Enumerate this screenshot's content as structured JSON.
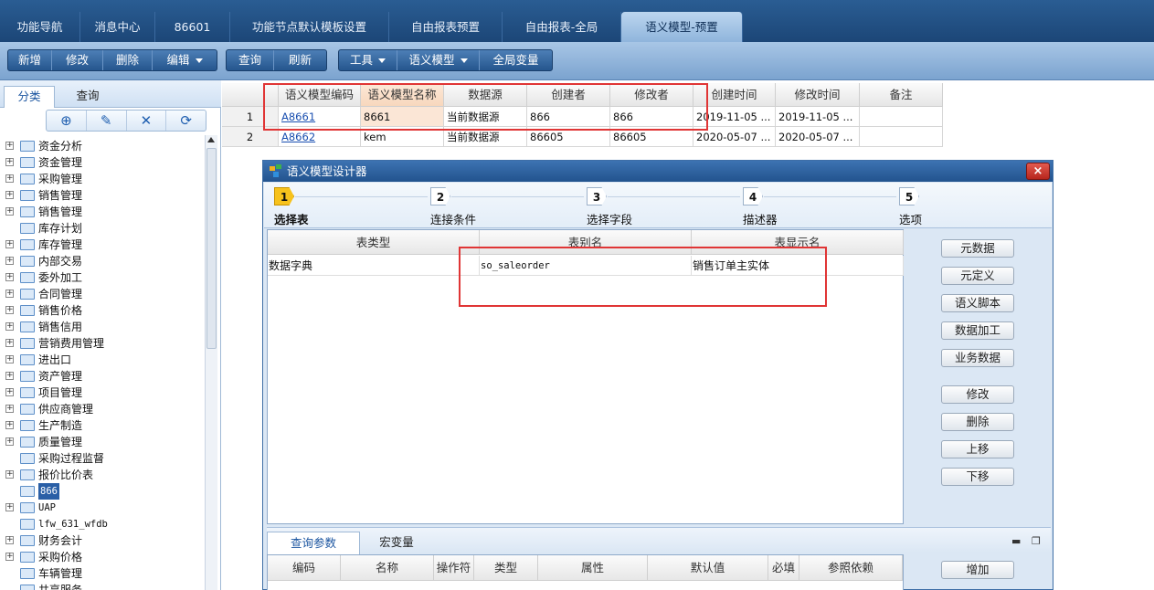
{
  "top_tabs": [
    {
      "label": "功能导航"
    },
    {
      "label": "消息中心"
    },
    {
      "label": "86601"
    },
    {
      "label": "功能节点默认模板设置"
    },
    {
      "label": "自由报表预置"
    },
    {
      "label": "自由报表-全局"
    },
    {
      "label": "语义模型-预置"
    }
  ],
  "toolbar": {
    "group1": [
      "新增",
      "修改",
      "删除",
      "编辑"
    ],
    "group2": [
      "查询",
      "刷新"
    ],
    "group3": [
      "工具",
      "语义模型",
      "全局变量"
    ]
  },
  "left_panel": {
    "tabs": [
      "分类",
      "查询"
    ],
    "tree": [
      {
        "label": "资金分析",
        "expandable": true
      },
      {
        "label": "资金管理",
        "expandable": true
      },
      {
        "label": "采购管理",
        "expandable": true
      },
      {
        "label": "销售管理",
        "expandable": true
      },
      {
        "label": "销售管理",
        "expandable": true
      },
      {
        "label": "库存计划",
        "expandable": false
      },
      {
        "label": "库存管理",
        "expandable": true
      },
      {
        "label": "内部交易",
        "expandable": true
      },
      {
        "label": "委外加工",
        "expandable": true
      },
      {
        "label": "合同管理",
        "expandable": true
      },
      {
        "label": "销售价格",
        "expandable": true
      },
      {
        "label": "销售信用",
        "expandable": true
      },
      {
        "label": "营销费用管理",
        "expandable": true
      },
      {
        "label": "进出口",
        "expandable": true
      },
      {
        "label": "资产管理",
        "expandable": true
      },
      {
        "label": "项目管理",
        "expandable": true
      },
      {
        "label": "供应商管理",
        "expandable": true
      },
      {
        "label": "生产制造",
        "expandable": true
      },
      {
        "label": "质量管理",
        "expandable": true
      },
      {
        "label": "采购过程监督",
        "expandable": false
      },
      {
        "label": "报价比价表",
        "expandable": true
      },
      {
        "label": "866",
        "expandable": false,
        "selected": true
      },
      {
        "label": "UAP",
        "expandable": true
      },
      {
        "label": "lfw_631_wfdb",
        "expandable": false
      },
      {
        "label": "财务会计",
        "expandable": true
      },
      {
        "label": "采购价格",
        "expandable": true
      },
      {
        "label": "车辆管理",
        "expandable": false
      },
      {
        "label": "共享服务",
        "expandable": false
      }
    ]
  },
  "grid": {
    "headers": [
      "语义模型编码",
      "语义模型名称",
      "数据源",
      "创建者",
      "修改者",
      "创建时间",
      "修改时间",
      "备注"
    ],
    "rows": [
      {
        "num": "1",
        "cells": [
          "A8661",
          "8661",
          "当前数据源",
          "866",
          "866",
          "2019-11-05 ...",
          "2019-11-05 ...",
          ""
        ]
      },
      {
        "num": "2",
        "cells": [
          "A8662",
          "kem",
          "当前数据源",
          "86605",
          "86605",
          "2020-05-07 ...",
          "2020-05-07 ...",
          ""
        ]
      }
    ]
  },
  "dialog": {
    "title": "语义模型设计器",
    "close": "×",
    "steps": [
      {
        "num": "1",
        "label": "选择表"
      },
      {
        "num": "2",
        "label": "连接条件"
      },
      {
        "num": "3",
        "label": "选择字段"
      },
      {
        "num": "4",
        "label": "描述器"
      },
      {
        "num": "5",
        "label": "选项"
      }
    ],
    "table_headers": [
      "表类型",
      "表别名",
      "表显示名"
    ],
    "table_row": [
      "数据字典",
      "so_saleorder",
      "销售订单主实体"
    ],
    "right_buttons": [
      "元数据",
      "元定义",
      "语义脚本",
      "数据加工",
      "业务数据",
      "修改",
      "删除",
      "上移",
      "下移"
    ],
    "bottom_tabs": [
      "查询参数",
      "宏变量"
    ],
    "param_headers": [
      "编码",
      "名称",
      "操作符",
      "类型",
      "属性",
      "默认值",
      "必填",
      "参照依赖"
    ],
    "bottom_buttons": [
      "增加"
    ]
  },
  "colors": {
    "highlight_box": "#e03535",
    "title_bar": "#22538e"
  }
}
